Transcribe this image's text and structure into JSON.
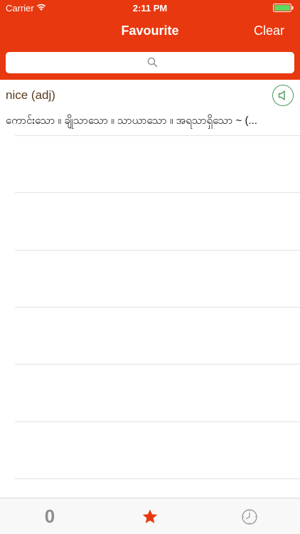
{
  "status_bar": {
    "carrier": "Carrier",
    "time": "2:11 PM"
  },
  "nav": {
    "title": "Favourite",
    "clear_label": "Clear"
  },
  "search": {
    "placeholder": "",
    "value": ""
  },
  "entries": [
    {
      "word": "nice (adj)",
      "definition": "ကောင်းသော ။ ချိုသာသော ။ သာယာသော ။ အရသာရှိသော ~ (..."
    }
  ],
  "tab_bar": {
    "tabs": [
      {
        "label": "0",
        "icon": "font-size-icon",
        "selected": false
      },
      {
        "label": "",
        "icon": "star-icon",
        "selected": true
      },
      {
        "label": "",
        "icon": "clock-icon",
        "selected": false
      }
    ]
  },
  "colors": {
    "brand": "#e8380f",
    "speaker_accent": "#4a9a5a",
    "entry_word": "#5a3b1e",
    "tab_inactive": "#8e8e8e"
  }
}
